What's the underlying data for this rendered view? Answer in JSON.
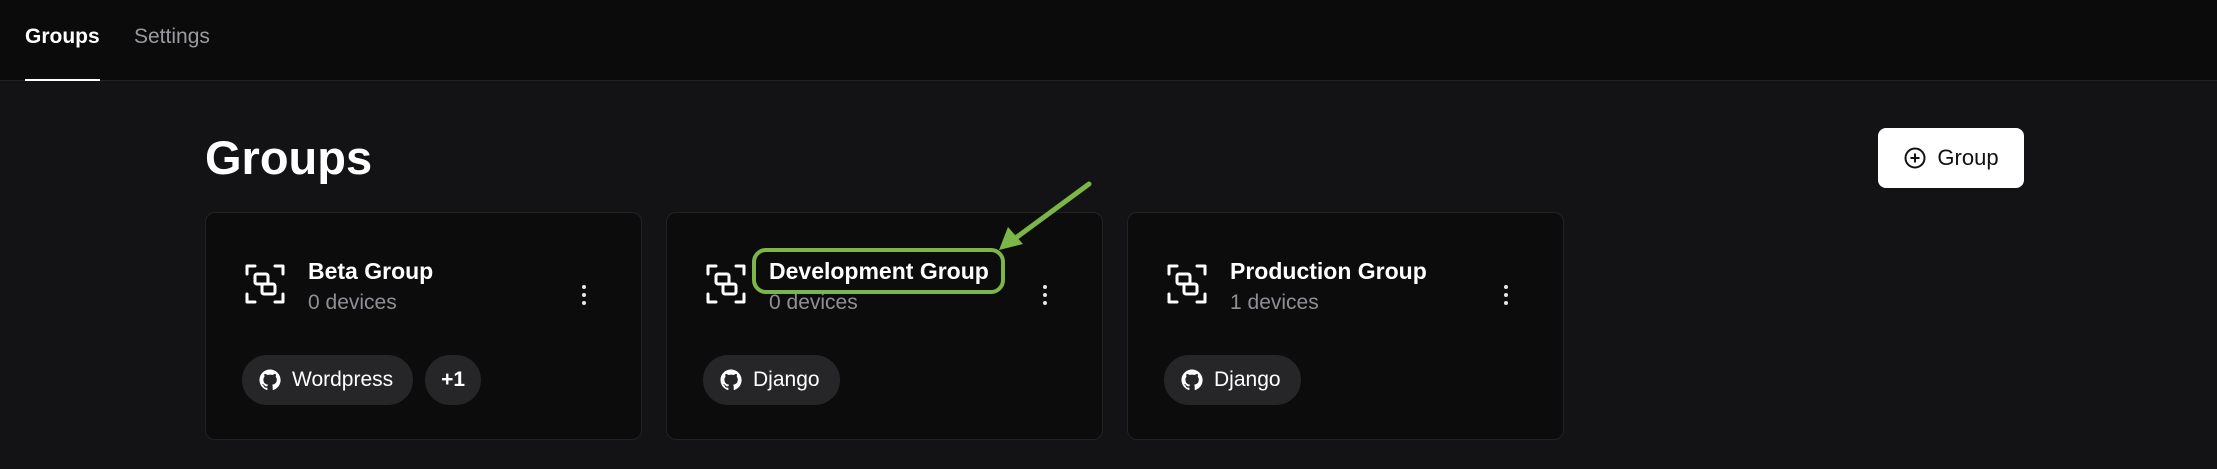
{
  "nav": {
    "tabs": [
      {
        "label": "Groups",
        "active": true
      },
      {
        "label": "Settings",
        "active": false
      }
    ]
  },
  "main": {
    "title": "Groups",
    "add_button": {
      "label": "Group",
      "icon": "plus-circle-icon"
    },
    "groups": [
      {
        "name": "Beta Group",
        "devices": "0 devices",
        "tags": [
          {
            "label": "Wordpress",
            "icon": "github-icon"
          },
          {
            "label": "+1"
          }
        ]
      },
      {
        "name": "Development Group",
        "devices": "0 devices",
        "tags": [
          {
            "label": "Django",
            "icon": "github-icon"
          }
        ],
        "highlighted": true
      },
      {
        "name": "Production Group",
        "devices": "1 devices",
        "tags": [
          {
            "label": "Django",
            "icon": "github-icon"
          }
        ]
      }
    ]
  },
  "colors": {
    "background": "#131315",
    "topbar": "#0b0b0c",
    "card": "#0c0c0d",
    "chip": "#262629",
    "annotation": "#7ab648"
  }
}
